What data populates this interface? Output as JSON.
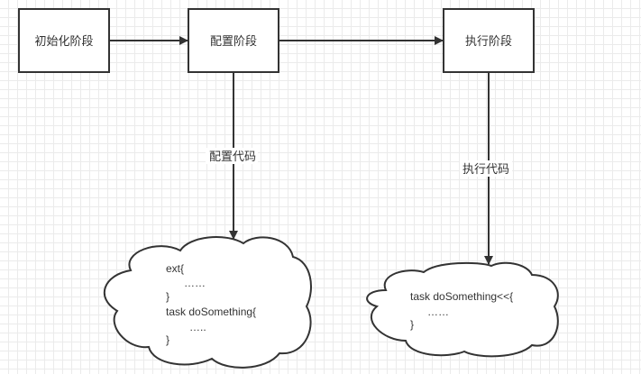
{
  "nodes": {
    "init": "初始化阶段",
    "config": "配置阶段",
    "exec": "执行阶段"
  },
  "edges": {
    "config_code": "配置代码",
    "exec_code": "执行代码"
  },
  "clouds": {
    "config": [
      "ext{",
      "……",
      "}",
      "task doSomething{",
      "…..",
      "}"
    ],
    "exec": [
      "task doSomething<<{",
      "……",
      "}"
    ]
  },
  "colors": {
    "stroke": "#333333",
    "grid": "#ebebeb"
  }
}
